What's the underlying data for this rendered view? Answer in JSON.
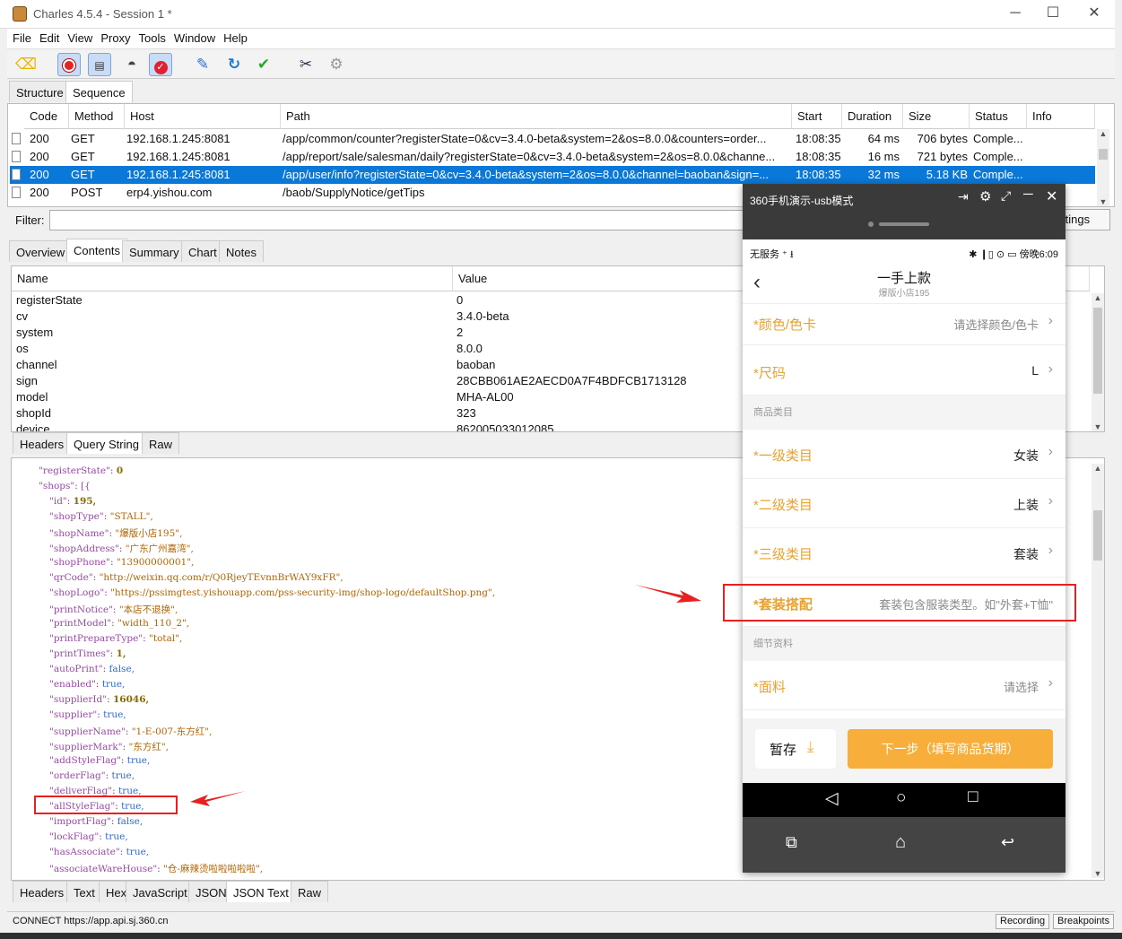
{
  "window": {
    "title": "Charles 4.5.4 - Session 1 *",
    "min_glyph": "─",
    "max_glyph": "☐",
    "close_glyph": "✕"
  },
  "menu": [
    "File",
    "Edit",
    "View",
    "Proxy",
    "Tools",
    "Window",
    "Help"
  ],
  "toolbar_icons": [
    "broom-icon",
    "record-icon",
    "throttle-icon",
    "turtle-icon",
    "breakpoint-icon",
    "pen-icon",
    "refresh-icon",
    "check-icon",
    "tools-icon",
    "gear-icon"
  ],
  "view_tabs": [
    "Structure",
    "Sequence"
  ],
  "sequence": {
    "headers": [
      "Code",
      "Method",
      "Host",
      "Path",
      "Start",
      "Duration",
      "Size",
      "Status",
      "Info"
    ],
    "rows": [
      {
        "code": "200",
        "method": "GET",
        "host": "192.168.1.245:8081",
        "path": "/app/common/counter?registerState=0&cv=3.4.0-beta&system=2&os=8.0.0&counters=order...",
        "start": "18:08:35",
        "duration": "64 ms",
        "size": "706 bytes",
        "status": "Comple..."
      },
      {
        "code": "200",
        "method": "GET",
        "host": "192.168.1.245:8081",
        "path": "/app/report/sale/salesman/daily?registerState=0&cv=3.4.0-beta&system=2&os=8.0.0&channe...",
        "start": "18:08:35",
        "duration": "16 ms",
        "size": "721 bytes",
        "status": "Comple..."
      },
      {
        "code": "200",
        "method": "GET",
        "host": "192.168.1.245:8081",
        "path": "/app/user/info?registerState=0&cv=3.4.0-beta&system=2&os=8.0.0&channel=baoban&sign=...",
        "start": "18:08:35",
        "duration": "32 ms",
        "size": "5.18 KB",
        "status": "Comple..."
      },
      {
        "code": "200",
        "method": "POST",
        "host": "erp4.yishou.com",
        "path": "/baob/SupplyNotice/getTips",
        "start": "",
        "duration": "",
        "size": "",
        "status": ""
      }
    ]
  },
  "filter": {
    "label": "Filter:",
    "settings": "ttings"
  },
  "detail_tabs": [
    "Overview",
    "Contents",
    "Summary",
    "Chart",
    "Notes"
  ],
  "query": {
    "headers": [
      "Name",
      "Value"
    ],
    "rows": [
      [
        "registerState",
        "0"
      ],
      [
        "cv",
        "3.4.0-beta"
      ],
      [
        "system",
        "2"
      ],
      [
        "os",
        "8.0.0"
      ],
      [
        "channel",
        "baoban"
      ],
      [
        "sign",
        "28CBB061AE2AECD0A7F4BDFCB1713128"
      ],
      [
        "model",
        "MHA-AL00"
      ],
      [
        "shopId",
        "323"
      ],
      [
        "device",
        "862005033012085"
      ]
    ]
  },
  "request_tabs": [
    "Headers",
    "Query String",
    "Raw"
  ],
  "json_lines": [
    {
      "i": 1,
      "k": "\"registerState\"",
      "v": "0",
      "t": "n"
    },
    {
      "i": 1,
      "k": "\"shops\"",
      "v": "[{",
      "t": "p"
    },
    {
      "i": 2,
      "k": "\"id\"",
      "v": "195,",
      "t": "n"
    },
    {
      "i": 2,
      "k": "\"shopType\"",
      "v": "\"STALL\",",
      "t": "s"
    },
    {
      "i": 2,
      "k": "\"shopName\"",
      "v": "\"爆版小店195\",",
      "t": "s"
    },
    {
      "i": 2,
      "k": "\"shopAddress\"",
      "v": "\"广东广州嘉湾\",",
      "t": "s"
    },
    {
      "i": 2,
      "k": "\"shopPhone\"",
      "v": "\"13900000001\",",
      "t": "s"
    },
    {
      "i": 2,
      "k": "\"qrCode\"",
      "v": "\"http://weixin.qq.com/r/Q0RjeyTEvnnBrWAY9xFR\",",
      "t": "s"
    },
    {
      "i": 2,
      "k": "\"shopLogo\"",
      "v": "\"https://pssimgtest.yishouapp.com/pss-security-img/shop-logo/defaultShop.png\",",
      "t": "s"
    },
    {
      "i": 2,
      "k": "\"printNotice\"",
      "v": "\"本店不退换\",",
      "t": "s"
    },
    {
      "i": 2,
      "k": "\"printModel\"",
      "v": "\"width_110_2\",",
      "t": "s"
    },
    {
      "i": 2,
      "k": "\"printPrepareType\"",
      "v": "\"total\",",
      "t": "s"
    },
    {
      "i": 2,
      "k": "\"printTimes\"",
      "v": "1,",
      "t": "n"
    },
    {
      "i": 2,
      "k": "\"autoPrint\"",
      "v": "false,",
      "t": "b"
    },
    {
      "i": 2,
      "k": "\"enabled\"",
      "v": "true,",
      "t": "b"
    },
    {
      "i": 2,
      "k": "\"supplierId\"",
      "v": "16046,",
      "t": "n"
    },
    {
      "i": 2,
      "k": "\"supplier\"",
      "v": "true,",
      "t": "b"
    },
    {
      "i": 2,
      "k": "\"supplierName\"",
      "v": "\"1-E-007-东方红\",",
      "t": "s"
    },
    {
      "i": 2,
      "k": "\"supplierMark\"",
      "v": "\"东方红\",",
      "t": "s"
    },
    {
      "i": 2,
      "k": "\"addStyleFlag\"",
      "v": "true,",
      "t": "b"
    },
    {
      "i": 2,
      "k": "\"orderFlag\"",
      "v": "true,",
      "t": "b"
    },
    {
      "i": 2,
      "k": "\"deliverFlag\"",
      "v": "true,",
      "t": "b"
    },
    {
      "i": 2,
      "k": "\"allStyleFlag\"",
      "v": "true,",
      "t": "b"
    },
    {
      "i": 2,
      "k": "\"importFlag\"",
      "v": "false,",
      "t": "b"
    },
    {
      "i": 2,
      "k": "\"lockFlag\"",
      "v": "true,",
      "t": "b"
    },
    {
      "i": 2,
      "k": "\"hasAssociate\"",
      "v": "true,",
      "t": "b"
    },
    {
      "i": 2,
      "k": "\"associateWareHouse\"",
      "v": "\"仓-麻辣烫啦啦啦啦啦\",",
      "t": "s"
    }
  ],
  "response_tabs": [
    "Headers",
    "Text",
    "Hex",
    "JavaScript",
    "JSON",
    "JSON Text",
    "Raw"
  ],
  "status": {
    "text": "CONNECT https://app.api.sj.360.cn",
    "recording": "Recording",
    "breakpoints": "Breakpoints"
  },
  "phone": {
    "window_title": "360手机演示-usb模式",
    "status_left": "无服务 ⁺ ⭳",
    "status_right": "✱ ❙▯ ⊙ ▭ 傍晚6:09",
    "page_title": "一手上款",
    "page_subtitle": "爆版小店195",
    "rows": [
      {
        "label": "*颜色/色卡",
        "value": "请选择颜色/色卡",
        "style": "placeholder"
      },
      {
        "label": "*尺码",
        "value": "L",
        "style": "value"
      },
      {
        "section": "商品类目"
      },
      {
        "label": "*一级类目",
        "value": "女装",
        "style": "value"
      },
      {
        "label": "*二级类目",
        "value": "上装",
        "style": "value"
      },
      {
        "label": "*三级类目",
        "value": "套装",
        "style": "value"
      },
      {
        "label": "*套装搭配",
        "value": "套装包含服装类型。如\"外套+T恤\"",
        "style": "placeholder",
        "bold": true
      },
      {
        "section": "细节资料"
      },
      {
        "label": "*面料",
        "value": "请选择",
        "style": "placeholder"
      }
    ],
    "save_btn": "暂存",
    "next_btn": "下一步（填写商品货期）",
    "accent": "#f8ae3a"
  }
}
